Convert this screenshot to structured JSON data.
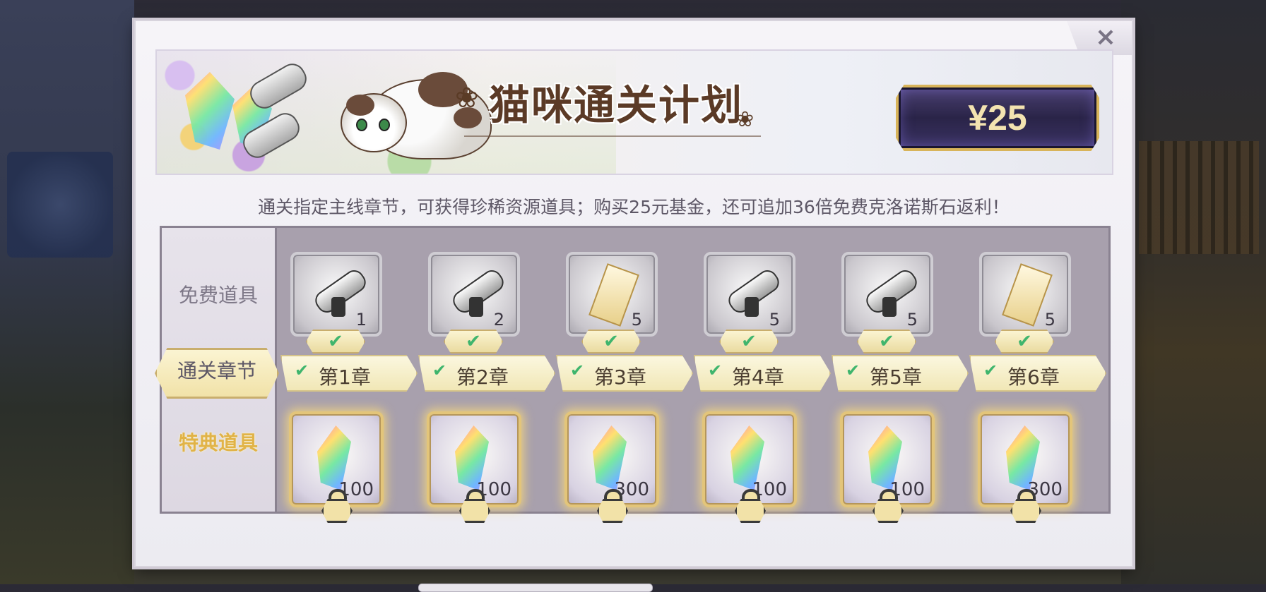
{
  "header": {
    "title": "猫咪通关计划",
    "price": "¥25"
  },
  "description": "通关指定主线章节，可获得珍稀资源道具；购买25元基金，还可追加36倍免费克洛诺斯石返利！",
  "rows": {
    "free_label": "免费道具",
    "chapter_label": "通关章节",
    "special_label": "特典道具"
  },
  "columns": [
    {
      "free_icon": "scroll-icon",
      "free_count": "1",
      "chapter": "第1章",
      "special_count": "100"
    },
    {
      "free_icon": "scroll-icon",
      "free_count": "2",
      "chapter": "第2章",
      "special_count": "100"
    },
    {
      "free_icon": "ticket-icon",
      "free_count": "5",
      "chapter": "第3章",
      "special_count": "300"
    },
    {
      "free_icon": "scroll-icon",
      "free_count": "5",
      "chapter": "第4章",
      "special_count": "100"
    },
    {
      "free_icon": "scroll-icon",
      "free_count": "5",
      "chapter": "第5章",
      "special_count": "100"
    },
    {
      "free_icon": "ticket-icon",
      "free_count": "5",
      "chapter": "第6章",
      "special_count": "300"
    }
  ],
  "glyphs": {
    "close": "×",
    "check": "✔",
    "paw": "❀"
  },
  "colors": {
    "accent_gold": "#e1b347",
    "check_green": "#3fb56d",
    "price_bg": "#2a2448"
  }
}
